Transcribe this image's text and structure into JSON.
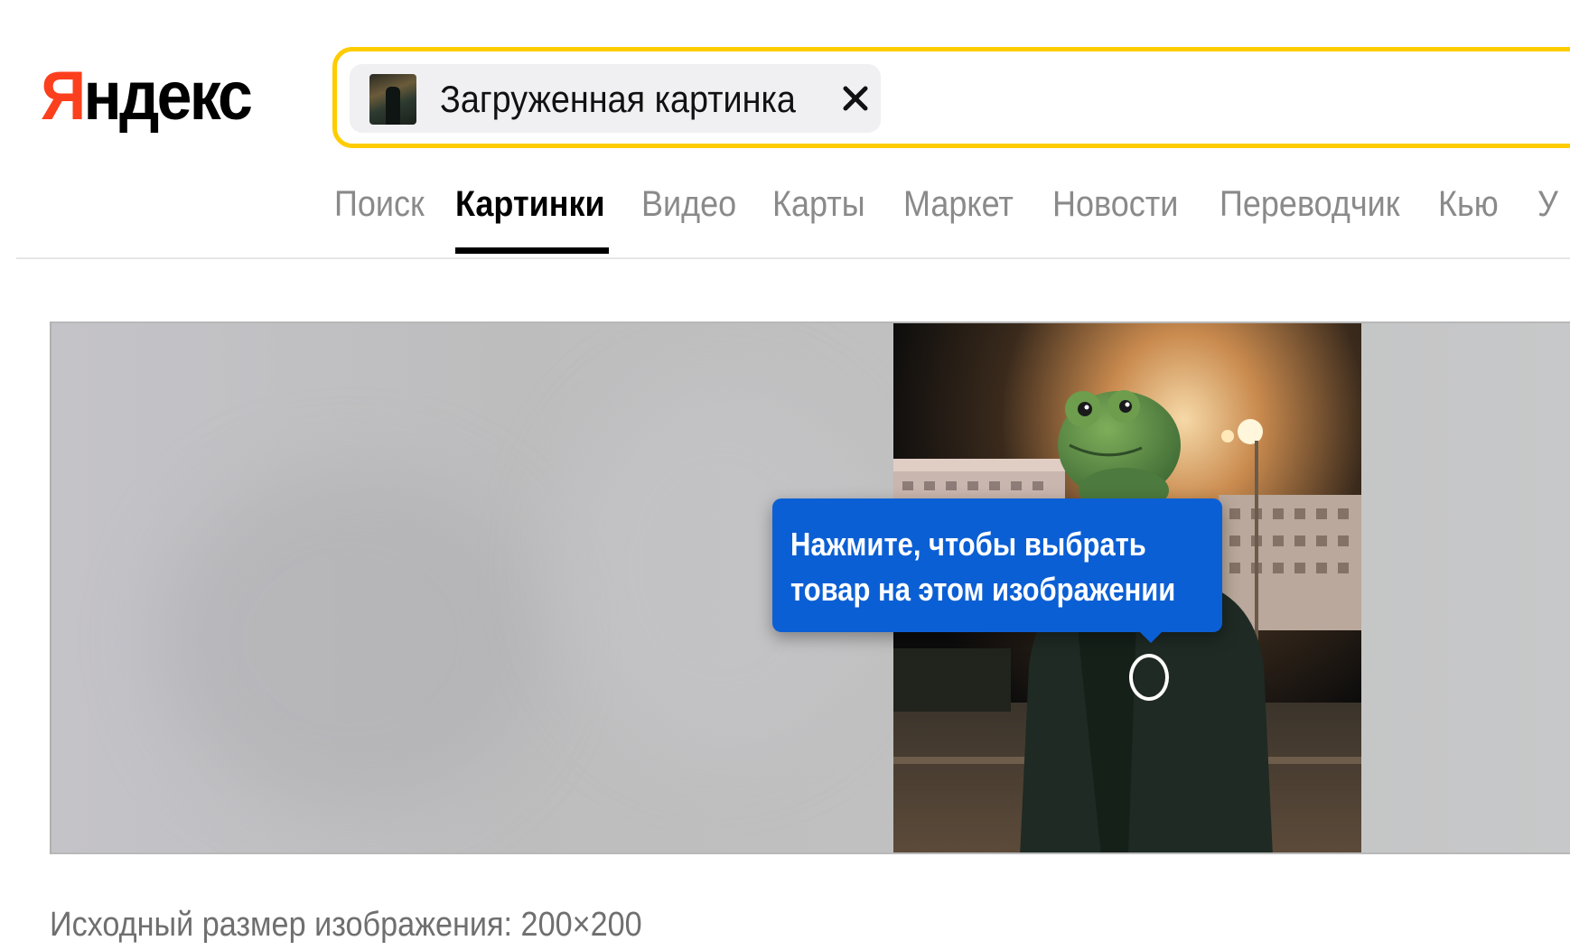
{
  "header": {
    "logo_first_letter": "Я",
    "logo_rest": "ндекс",
    "search_chip_label": "Загруженная картинка",
    "search_chip_close": "×"
  },
  "nav": {
    "tabs": [
      {
        "label": "Поиск",
        "active": false
      },
      {
        "label": "Картинки",
        "active": true
      },
      {
        "label": "Видео",
        "active": false
      },
      {
        "label": "Карты",
        "active": false
      },
      {
        "label": "Маркет",
        "active": false
      },
      {
        "label": "Новости",
        "active": false
      },
      {
        "label": "Переводчик",
        "active": false
      },
      {
        "label": "Кью",
        "active": false
      },
      {
        "label": "У",
        "active": false
      }
    ]
  },
  "viewer": {
    "tooltip_line1": "Нажмите, чтобы выбрать",
    "tooltip_line2": "товар на этом изображении"
  },
  "footer": {
    "size_label": "Исходный размер изображения: 200×200"
  },
  "colors": {
    "logo_accent": "#fc3f1d",
    "search_border": "#ffcc00",
    "tooltip_bg": "#0b5fd4"
  }
}
